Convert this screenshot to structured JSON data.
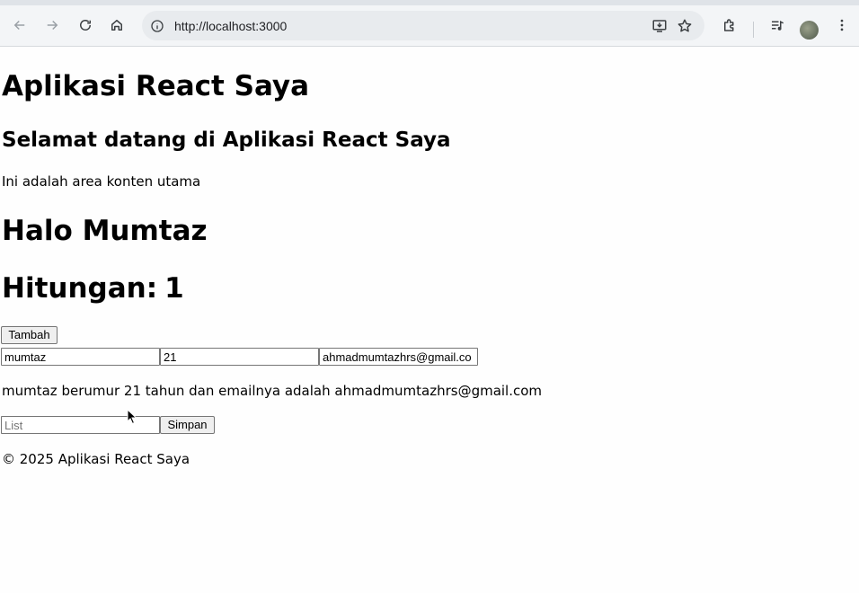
{
  "browser": {
    "url": "http://localhost:3000",
    "icons": {
      "back": "arrow-left-icon",
      "forward": "arrow-right-icon",
      "reload": "reload-icon",
      "home": "home-icon",
      "site_info": "info-icon",
      "install": "install-app-icon",
      "bookmark": "star-icon",
      "extensions": "puzzle-icon",
      "media": "media-control-icon",
      "menu": "kebab-menu-icon"
    }
  },
  "page": {
    "app_title": "Aplikasi React Saya",
    "welcome_heading": "Selamat datang di Aplikasi React Saya",
    "intro_text": "Ini adalah area konten utama",
    "greeting": "Halo Mumtaz",
    "counter_label": "Hitungan:",
    "counter_value": "1",
    "add_button_label": "Tambah",
    "form": {
      "name_value": "mumtaz",
      "age_value": "21",
      "email_value": "ahmadmumtazhrs@gmail.co"
    },
    "summary_text": "mumtaz berumur 21 tahun dan emailnya adalah ahmadmumtazhrs@gmail.com",
    "list_placeholder": "List",
    "save_button_label": "Simpan",
    "footer_text": "© 2025 Aplikasi React Saya"
  }
}
